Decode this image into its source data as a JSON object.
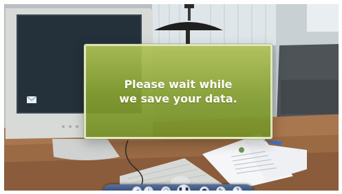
{
  "dialog": {
    "line1": "Please wait while",
    "line2": "we save your data."
  },
  "controls": [
    "back-icon",
    "info-icon",
    "search-icon",
    "pause-icon",
    "settings-icon",
    "edit-icon",
    "help-icon"
  ],
  "colors": {
    "dialog_fill": "#93ad3a",
    "dialog_border": "#eef2d7",
    "dialog_text": "#ffffff",
    "control_bar": "#2e4672"
  }
}
